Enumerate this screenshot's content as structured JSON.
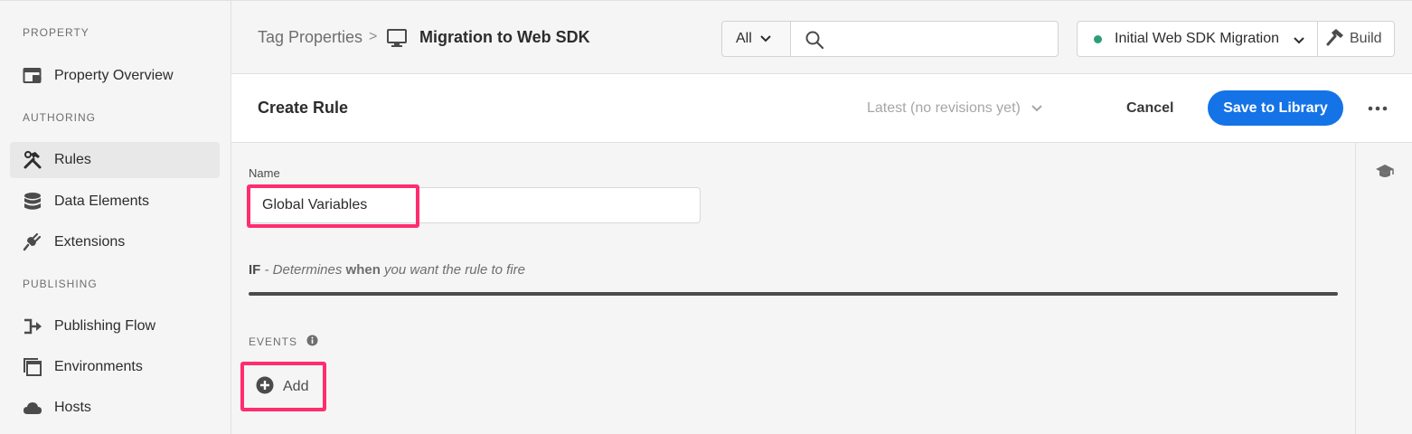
{
  "sidebar": {
    "sections": {
      "property": "PROPERTY",
      "authoring": "AUTHORING",
      "publishing": "PUBLISHING"
    },
    "items": {
      "property_overview": "Property Overview",
      "rules": "Rules",
      "data_elements": "Data Elements",
      "extensions": "Extensions",
      "publishing_flow": "Publishing Flow",
      "environments": "Environments",
      "hosts": "Hosts"
    },
    "active_item": "Rules"
  },
  "topbar": {
    "breadcrumb_parent": "Tag Properties",
    "breadcrumb_separator": ">",
    "breadcrumb_current": "Migration to Web SDK",
    "scope_select_value": "All",
    "search_value": "",
    "library_select_value": "Initial Web SDK Migration",
    "library_status_color": "#2d9d78",
    "build_label": "Build"
  },
  "header": {
    "title": "Create Rule",
    "revision_select_value": "Latest (no revisions yet)",
    "cancel_label": "Cancel",
    "save_label": "Save to Library"
  },
  "form": {
    "name_label": "Name",
    "name_value": "Global Variables",
    "if_keyword": "IF",
    "if_prefix": " - Determines ",
    "if_when": "when",
    "if_suffix": " you want the rule to fire",
    "events_label": "EVENTS",
    "add_label": "Add"
  },
  "colors": {
    "accent": "#1473e6",
    "highlight": "#ff2d6f"
  },
  "icons": {
    "property_overview": "property-overview-icon",
    "rules": "hammer-wrench-icon",
    "data_elements": "database-icon",
    "extensions": "plug-icon",
    "publishing_flow": "publishing-flow-icon",
    "environments": "window-stack-icon",
    "hosts": "cloud-icon",
    "breadcrumb_device": "monitor-icon",
    "search": "search-icon",
    "build": "hammer-icon",
    "more": "more-horizontal-icon",
    "learn": "graduation-cap-icon",
    "info": "info-icon",
    "add": "add-circle-icon"
  }
}
